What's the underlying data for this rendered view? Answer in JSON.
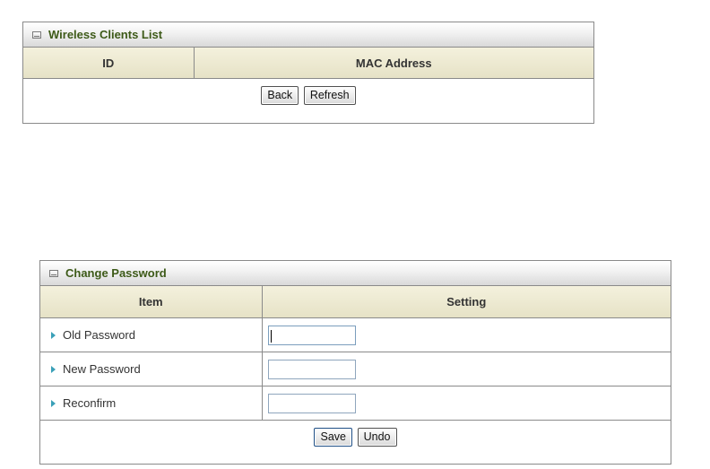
{
  "wireless_clients": {
    "title": "Wireless Clients List",
    "columns": [
      "ID",
      "MAC Address"
    ],
    "rows": [],
    "buttons": {
      "back": "Back",
      "refresh": "Refresh"
    }
  },
  "change_password": {
    "title": "Change Password",
    "columns": [
      "Item",
      "Setting"
    ],
    "fields": [
      {
        "label": "Old Password",
        "value": ""
      },
      {
        "label": "New Password",
        "value": ""
      },
      {
        "label": "Reconfirm",
        "value": ""
      }
    ],
    "buttons": {
      "save": "Save",
      "undo": "Undo"
    }
  },
  "colors": {
    "title_text": "#3d5a18",
    "header_bg": "#e6e2c6",
    "bullet": "#3aa0b8",
    "border": "#8a8a8a"
  }
}
